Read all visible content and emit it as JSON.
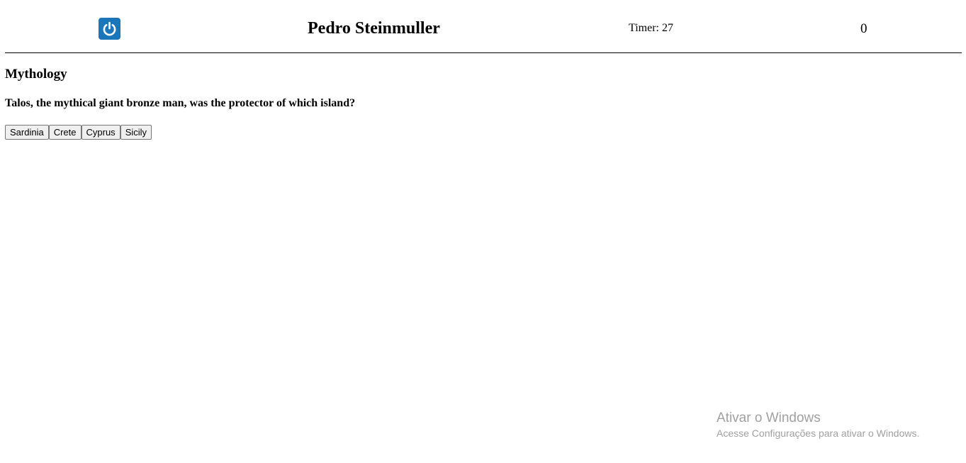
{
  "header": {
    "logout_icon": "power-icon",
    "logout_color": "#1a76b8",
    "player_name": "Pedro Steinmuller",
    "timer_label": "Timer: 27",
    "score": "0"
  },
  "quiz": {
    "category": "Mythology",
    "question": "Talos, the mythical giant bronze man, was the protector of which island?",
    "answers": [
      "Sardinia",
      "Crete",
      "Cyprus",
      "Sicily"
    ]
  },
  "watermark": {
    "title": "Ativar o Windows",
    "subtitle": "Acesse Configurações para ativar o Windows."
  }
}
